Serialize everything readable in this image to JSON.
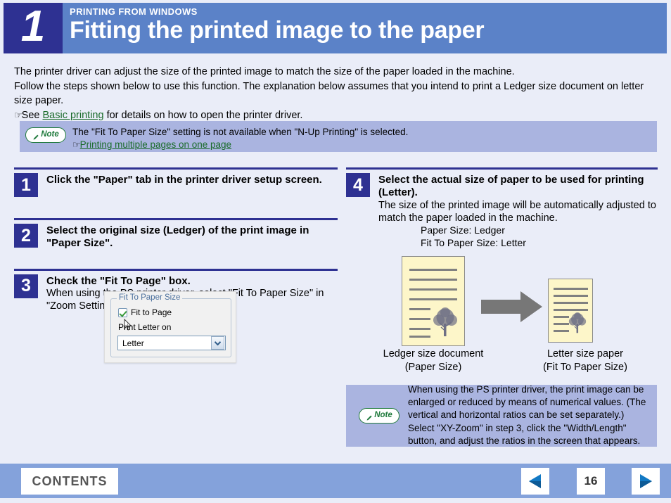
{
  "header": {
    "chapter_number": "1",
    "kicker": "PRINTING FROM WINDOWS",
    "title": "Fitting the printed image to the paper",
    "navy": "#2e3192",
    "blue": "#5b82c8"
  },
  "intro": {
    "line1": "The printer driver can adjust the size of the printed image to match the size of the paper loaded in the machine.",
    "line2": "Follow the steps shown below to use this function. The explanation below assumes that you intend to print a Ledger size document on letter size paper.",
    "see_prefix": "See ",
    "see_link": "Basic printing",
    "see_suffix": " for details on how to open the printer driver.",
    "hand_glyph": "☞"
  },
  "note_top": {
    "badge": "Note",
    "text": "The \"Fit To Paper Size\" setting is not available when \"N-Up Printing\" is selected.",
    "link": "Printing multiple pages on one page",
    "hand_glyph": "☞",
    "bg": "#aab4e0",
    "accent": "#1f7a3c"
  },
  "note_bottom": {
    "badge": "Note",
    "text": "When using the PS printer driver, the print image can be enlarged or reduced by means of numerical values. (The vertical and horizontal ratios can be set separately.) Select \"XY-Zoom\" in step 3, click the \"Width/Length\" button, and adjust the ratios in the screen that appears.",
    "bg": "#aab4e0",
    "accent": "#1f7a3c"
  },
  "steps_left": [
    {
      "number": "1",
      "title": "Click the \"Paper\" tab in the printer driver setup screen.",
      "desc": ""
    },
    {
      "number": "2",
      "title": "Select the original size (Ledger) of the print image in \"Paper Size\".",
      "desc": ""
    },
    {
      "number": "3",
      "title": "Check the \"Fit To Page\" box.",
      "desc": "When using the PS printer driver, select \"Fit To Paper Size\" in \"Zoom Setting\"."
    }
  ],
  "steps_right": [
    {
      "number": "4",
      "title": "Select the actual size of paper to be used for printing (Letter).",
      "desc": "The size of the printed image will be automatically adjusted to match the paper loaded in the machine."
    }
  ],
  "dialog": {
    "groupbox_title": "Fit To Paper Size",
    "checkbox_label_a": "Fit to Pa",
    "checkbox_label_underline": "g",
    "checkbox_label_b": "e",
    "checkbox_checked": true,
    "print_on_label": "Print Letter on",
    "combo_value": "Letter",
    "combo_arrow": "⌄"
  },
  "diagram": {
    "caption_line1": "Paper Size: Ledger",
    "caption_line2": "Fit To Paper Size: Letter",
    "left_label_line1": "Ledger size document",
    "left_label_line2": "(Paper Size)",
    "right_label_line1": "Letter size paper",
    "right_label_line2": "(Fit To Paper Size)",
    "doc_fill": "#fdf6c9",
    "doc_border": "#8a8a8a",
    "arrow_color": "#777777"
  },
  "footer": {
    "contents_label": "CONTENTS",
    "page_number": "16",
    "prev_label": "◀",
    "next_label": "▶",
    "bar_color": "#84a2db"
  }
}
